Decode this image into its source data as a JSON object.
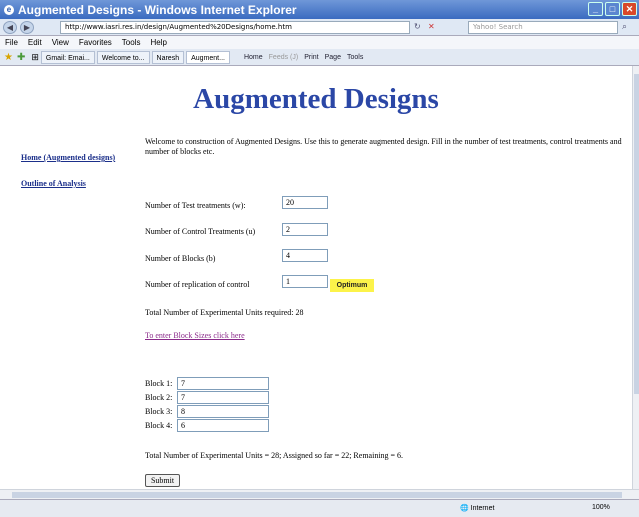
{
  "window": {
    "title": "Augmented Designs - Windows Internet Explorer"
  },
  "address": {
    "url": "http://www.iasri.res.in/design/Augmented%20Designs/home.htm",
    "search_placeholder": "Yahoo! Search"
  },
  "menu": [
    "File",
    "Edit",
    "View",
    "Favorites",
    "Tools",
    "Help"
  ],
  "tabs": [
    "Gmail: Emai...",
    "Welcome to...",
    "Naresh",
    "Augment..."
  ],
  "toolbar": {
    "home": "Home",
    "feeds": "Feeds (J)",
    "print": "Print",
    "page": "Page",
    "tools": "Tools"
  },
  "page": {
    "heading": "Augmented Designs",
    "intro": "Welcome to construction of Augmented Designs. Use this to generate augmented design. Fill in the number of test treatments, control treatments and number of blocks etc.",
    "sidebar": [
      "Home (Augmented designs)",
      "Outline of Analysis"
    ],
    "fields": {
      "test": {
        "label": "Number of Test treatments (w):",
        "value": "20"
      },
      "control": {
        "label": "Number of Control Treatments (u)",
        "value": "2"
      },
      "blocks": {
        "label": "Number of Blocks (b)",
        "value": "4"
      },
      "replication": {
        "label": "Number of replication of control",
        "value": "1"
      }
    },
    "optimum": "Optimum",
    "total_units": "Total Number of Experimental Units required: 28",
    "block_link": "To enter Block Sizes click here",
    "block_sizes": [
      {
        "label": "Block 1:",
        "value": "7"
      },
      {
        "label": "Block 2:",
        "value": "7"
      },
      {
        "label": "Block 3:",
        "value": "8"
      },
      {
        "label": "Block 4:",
        "value": "6"
      }
    ],
    "summary": "Total Number of Experimental Units = 28; Assigned so far = 22; Remaining = 6.",
    "submit": "Submit"
  },
  "status": {
    "zone": "Internet",
    "zoom": "100%"
  }
}
